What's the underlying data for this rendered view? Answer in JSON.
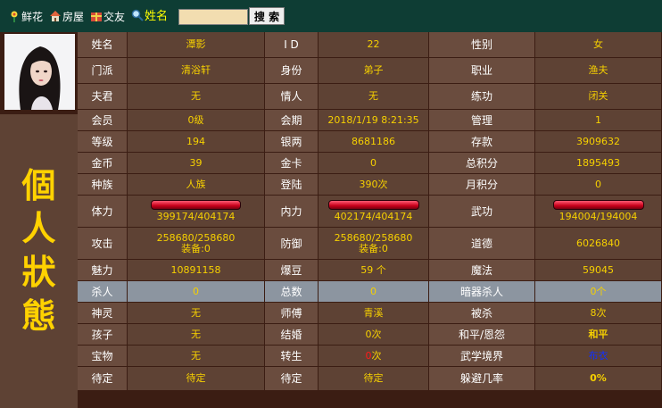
{
  "nav": {
    "items": [
      {
        "label": "鲜花",
        "icon": "flower-icon"
      },
      {
        "label": "房屋",
        "icon": "house-icon"
      },
      {
        "label": "交友",
        "icon": "friends-icon"
      },
      {
        "label": "姓名",
        "icon": "magnifier-icon"
      }
    ],
    "search_value": "",
    "search_button": "搜 索"
  },
  "side": {
    "title_chars": [
      "個",
      "人",
      "狀",
      "態"
    ]
  },
  "colors": {
    "top_bar": "#0e3d34",
    "page_bg": "#3b1d13",
    "value": "#f6d000",
    "label": "#ffffff",
    "bar": "#c8001a",
    "highlight_row": "#8c95a0"
  },
  "rows": [
    {
      "cells": [
        "姓名",
        "潭影",
        "I D",
        "22",
        "性别",
        "女"
      ]
    },
    {
      "cells": [
        "门派",
        "清浴轩",
        "身份",
        "弟子",
        "职业",
        "渔夫"
      ]
    },
    {
      "cells": [
        "夫君",
        "无",
        "情人",
        "无",
        "练功",
        "闭关"
      ]
    },
    {
      "cells": [
        "会员",
        "0级",
        "会期",
        "2018/1/19 8:21:35",
        "管理",
        "1"
      ]
    },
    {
      "cells": [
        "等级",
        "194",
        "银两",
        "8681186",
        "存款",
        "3909632"
      ]
    },
    {
      "cells": [
        "金币",
        "39",
        "金卡",
        "0",
        "总积分",
        "1895493"
      ]
    },
    {
      "cells": [
        "种族",
        "人族",
        "登陆",
        "390次",
        "月积分",
        "0"
      ]
    },
    {
      "bars": true,
      "cells": [
        "体力",
        "399174/404174",
        "内力",
        "402174/404174",
        "武功",
        "194004/194004"
      ],
      "fill": [
        0.988,
        0.995,
        1.0
      ]
    },
    {
      "cells": [
        "攻击",
        "258680/258680",
        "防御",
        "258680/258680",
        "道德",
        "6026840"
      ],
      "sub": [
        "装备:0",
        "装备:0"
      ]
    },
    {
      "cells": [
        "魅力",
        "10891158",
        "爆豆",
        "59 个",
        "魔法",
        "59045"
      ]
    },
    {
      "highlight": true,
      "cells": [
        "杀人",
        "0",
        "总数",
        "0",
        "暗器杀人",
        "0个"
      ]
    },
    {
      "cells": [
        "神灵",
        "无",
        "师傅",
        "青溪",
        "被杀",
        "8次"
      ]
    },
    {
      "cells": [
        "孩子",
        "无",
        "结婚",
        "0次",
        "和平/恩怨",
        "和平"
      ]
    },
    {
      "cells": [
        "宝物",
        "无",
        "转生",
        "0次",
        "武学境界",
        "布衣"
      ],
      "transmig": {
        "num": "0",
        "unit": "次"
      }
    },
    {
      "cells": [
        "待定",
        "待定",
        "待定",
        "待定",
        "躲避几率",
        "0%"
      ]
    }
  ]
}
